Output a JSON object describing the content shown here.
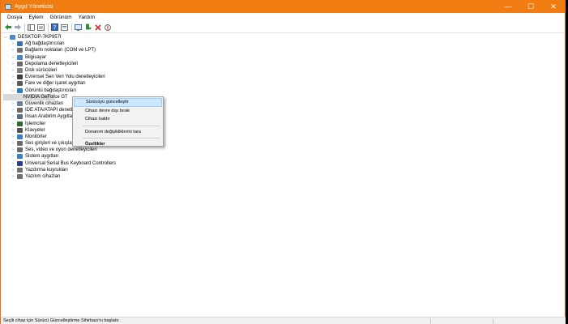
{
  "window": {
    "title": "Aygıt Yöneticisi"
  },
  "controls": {
    "minimize": "—",
    "maximize": "☐",
    "close": "✕"
  },
  "menu": [
    "Dosya",
    "Eylem",
    "Görünüm",
    "Yardım"
  ],
  "tree": {
    "root": "DESKTOP-7KP957I",
    "items": [
      {
        "label": "Ağ bağdaştırıcıları",
        "icon": "network-icon",
        "color": "#3b6fb6"
      },
      {
        "label": "Bağlantı noktaları (COM ve LPT)",
        "icon": "port-icon",
        "color": "#707070"
      },
      {
        "label": "Bilgisayar",
        "icon": "computer-icon",
        "color": "#4a87c8"
      },
      {
        "label": "Depolama denetleyicileri",
        "icon": "storage-icon",
        "color": "#6a6a6a"
      },
      {
        "label": "Disk sürücüleri",
        "icon": "disk-icon",
        "color": "#808080"
      },
      {
        "label": "Evrensel Seri Veri Yolu denetleyicileri",
        "icon": "usb-icon",
        "color": "#404040"
      },
      {
        "label": "Fare ve diğer işaret aygıtları",
        "icon": "mouse-icon",
        "color": "#5a5a5a"
      },
      {
        "label": "Görüntü bağdaştırıcıları",
        "icon": "display-adapter-icon",
        "color": "#2f7bbf"
      },
      {
        "label": "NVIDIA GeForce GT",
        "icon": "gpu-icon",
        "color": "#2f7bbf"
      },
      {
        "label": "Güvenlik cihazları",
        "icon": "security-icon",
        "color": "#6b7f95"
      },
      {
        "label": "IDE ATA/ATAPI denetle",
        "icon": "ide-icon",
        "color": "#6a6a6a"
      },
      {
        "label": "İnsan Arabirim Aygıtla",
        "icon": "hid-icon",
        "color": "#5b6f85"
      },
      {
        "label": "İşlemciler",
        "icon": "processor-icon",
        "color": "#2e6b2e"
      },
      {
        "label": "Klavyeler",
        "icon": "keyboard-icon",
        "color": "#555555"
      },
      {
        "label": "Monitörler",
        "icon": "monitor-icon",
        "color": "#3d7fc4"
      },
      {
        "label": "Ses girişleri ve çıkışları",
        "icon": "audio-io-icon",
        "color": "#6a6a6a"
      },
      {
        "label": "Ses, video ve oyun denetleyicileri",
        "icon": "sound-icon",
        "color": "#6a6a6a"
      },
      {
        "label": "Sistem aygıtları",
        "icon": "system-icon",
        "color": "#3d7fc4"
      },
      {
        "label": "Universal Serial Bus Keyboard Controllers",
        "icon": "usb-keyboard-icon",
        "color": "#2a3f8c"
      },
      {
        "label": "Yazdırma kuyrukları",
        "icon": "printer-icon",
        "color": "#707070"
      },
      {
        "label": "Yazılım cihazları",
        "icon": "software-device-icon",
        "color": "#707070"
      }
    ]
  },
  "context_menu": {
    "update_driver": "Sürücüyü güncelleştir",
    "disable_device": "Cihazı devre dışı bırak",
    "uninstall_device": "Cihazı kaldır",
    "scan_changes": "Donanım değişikliklerini tara",
    "properties": "Özellikler"
  },
  "status": {
    "text": "Seçili cihaz için Sürücü Güncelleştirme Sihirbazı'nı başlatır."
  }
}
